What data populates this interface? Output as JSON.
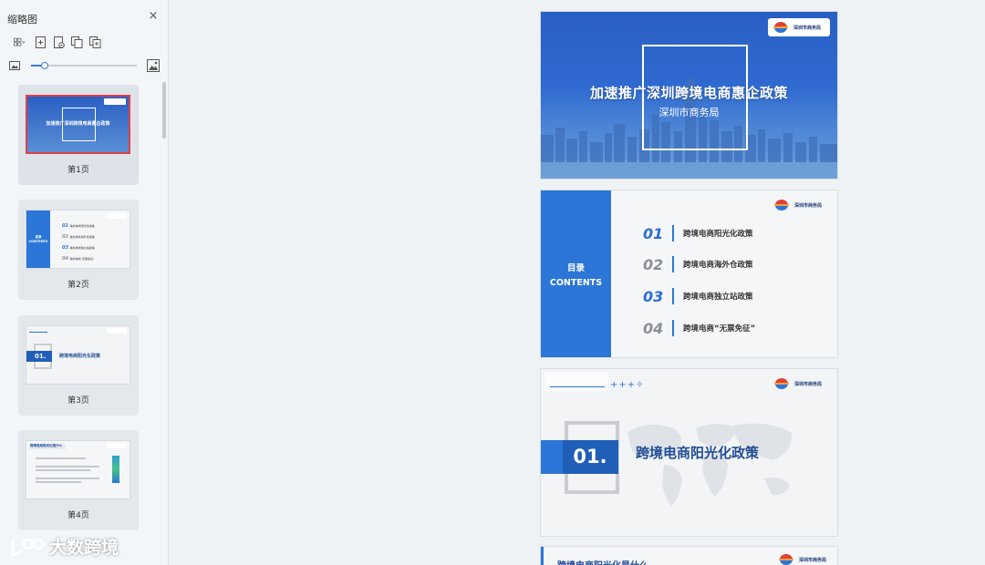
{
  "panel": {
    "title": "缩略图",
    "close_symbol": "×",
    "zoom_level": 0.13
  },
  "thumbnails": [
    {
      "label": "第1页"
    },
    {
      "label": "第2页"
    },
    {
      "label": "第3页"
    },
    {
      "label": "第4页"
    }
  ],
  "slide1": {
    "title": "加速推广深圳跨境电商惠企政策",
    "subtitle": "深圳市商务局"
  },
  "slide2": {
    "left_title": "目录",
    "left_sub": "CONTENTS",
    "items": [
      {
        "num": "01",
        "text": "跨境电商阳光化政策",
        "color": "#2b6fd1"
      },
      {
        "num": "02",
        "text": "跨境电商海外仓政策",
        "color": "#8a8f96"
      },
      {
        "num": "03",
        "text": "跨境电商独立站政策",
        "color": "#2b6fd1"
      },
      {
        "num": "04",
        "text": "跨境电商“无票免征”",
        "color": "#8a8f96"
      }
    ]
  },
  "slide3": {
    "num": "01.",
    "title": "跨境电商阳光化政策",
    "deco": "+++✧"
  },
  "slide4": {
    "title": "跨境电商阳光化是什么"
  },
  "logo_text": "深圳市商务局",
  "watermark": "大数跨境",
  "colors": {
    "accent": "#2b76d6",
    "selected_border": "#e0404a"
  }
}
